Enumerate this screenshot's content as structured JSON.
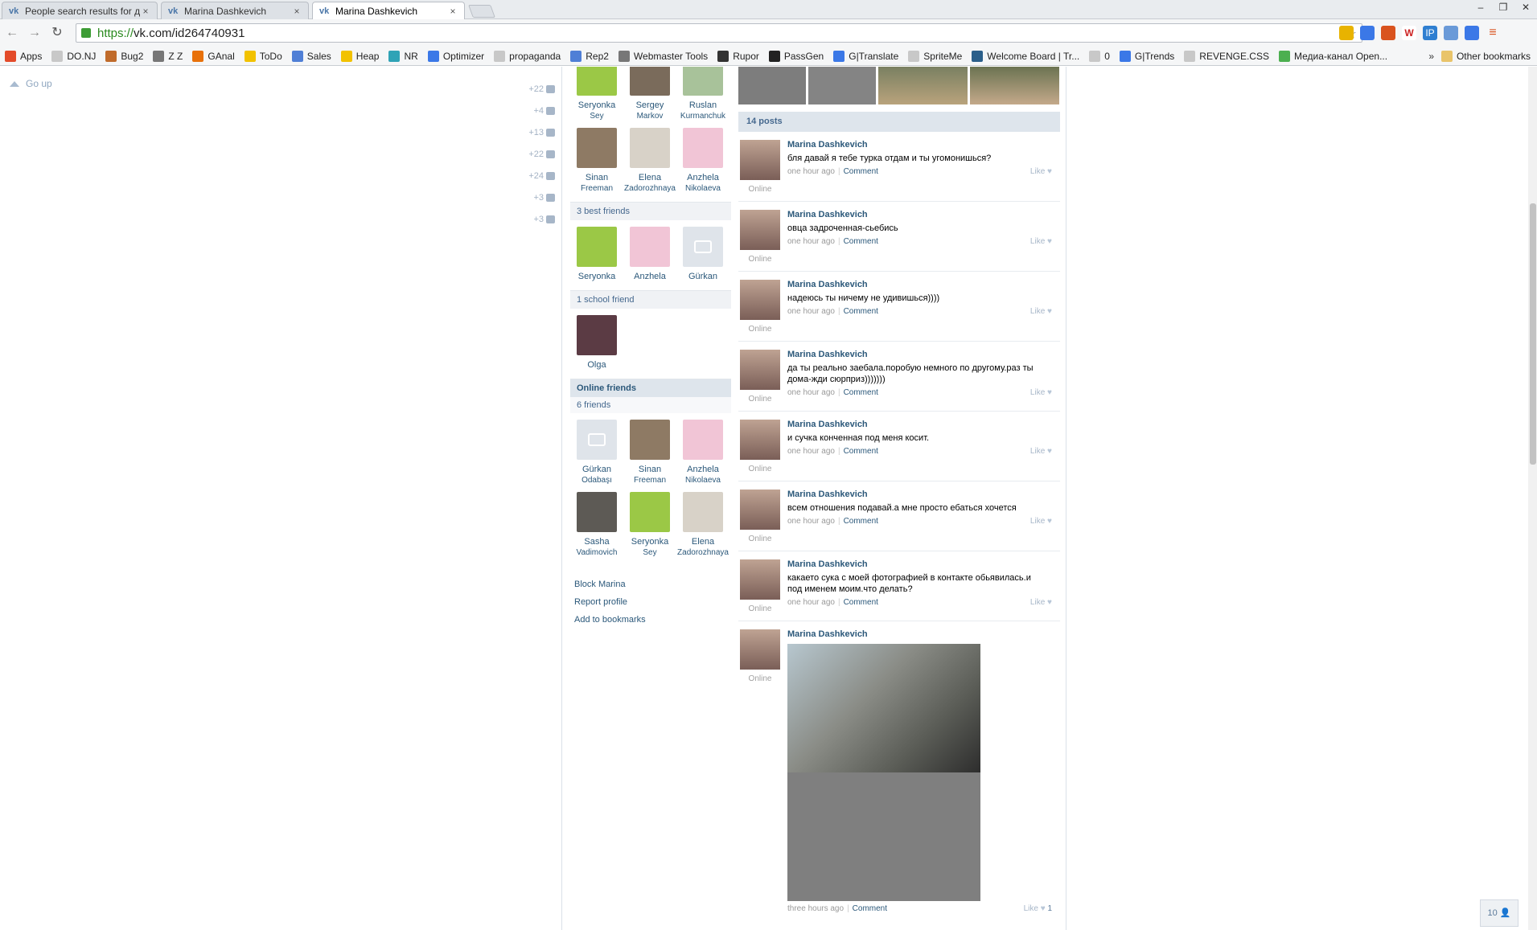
{
  "browser": {
    "tabs": [
      {
        "title": "People search results for д",
        "active": false
      },
      {
        "title": "Marina Dashkevich",
        "active": false
      },
      {
        "title": "Marina Dashkevich",
        "active": true
      }
    ],
    "url_scheme": "https://",
    "url_rest": "vk.com/id264740931",
    "bookmarks": [
      {
        "label": "Apps",
        "icon": "apps-grid-icon",
        "color": "#e34b2a"
      },
      {
        "label": "DO.NJ",
        "icon": "page-icon",
        "color": "#c8c8c8"
      },
      {
        "label": "Bug2",
        "icon": "bug-icon",
        "color": "#c06b2b"
      },
      {
        "label": "Z Z",
        "icon": "zz-icon",
        "color": "#777777"
      },
      {
        "label": "GAnal",
        "icon": "chart-icon",
        "color": "#e8710a"
      },
      {
        "label": "ToDo",
        "icon": "todo-icon",
        "color": "#f2c200"
      },
      {
        "label": "Sales",
        "icon": "sales-icon",
        "color": "#4f7fd6"
      },
      {
        "label": "Heap",
        "icon": "heap-icon",
        "color": "#f2c200"
      },
      {
        "label": "NR",
        "icon": "nr-icon",
        "color": "#2fa3b6"
      },
      {
        "label": "Optimizer",
        "icon": "google-icon",
        "color": "#3b78e7"
      },
      {
        "label": "propaganda",
        "icon": "page-icon",
        "color": "#c8c8c8"
      },
      {
        "label": "Rep2",
        "icon": "rep-icon",
        "color": "#4f7fd6"
      },
      {
        "label": "Webmaster Tools",
        "icon": "webmaster-icon",
        "color": "#777777"
      },
      {
        "label": "Rupor",
        "icon": "rupor-icon",
        "color": "#333333"
      },
      {
        "label": "PassGen",
        "icon": "passgen-icon",
        "color": "#222222"
      },
      {
        "label": "G|Translate",
        "icon": "translate-icon",
        "color": "#3b78e7"
      },
      {
        "label": "SpriteMe",
        "icon": "page-icon",
        "color": "#c8c8c8"
      },
      {
        "label": "Welcome Board | Tr...",
        "icon": "trello-icon",
        "color": "#2b5f8a"
      },
      {
        "label": "0",
        "icon": "page-icon",
        "color": "#c8c8c8"
      },
      {
        "label": "G|Trends",
        "icon": "google-icon",
        "color": "#3b78e7"
      },
      {
        "label": "REVENGE.CSS",
        "icon": "page-icon",
        "color": "#c8c8c8"
      },
      {
        "label": "Медиа-канал Open...",
        "icon": "media-icon",
        "color": "#4caf50"
      }
    ],
    "other_bookmarks": "Other bookmarks",
    "chevron": "»"
  },
  "page": {
    "go_up": "Go up",
    "counters": [
      "+22",
      "+4",
      "+13",
      "+22",
      "+24",
      "+3",
      "+3"
    ],
    "friends_top": [
      {
        "first": "Seryonka",
        "last": "Sey",
        "avatar": "#9bc846"
      },
      {
        "first": "Sergey",
        "last": "Markov",
        "avatar": "#7a6b5b"
      },
      {
        "first": "Ruslan",
        "last": "Kurmanchuk",
        "avatar": "#a8c29a"
      },
      {
        "first": "Sinan",
        "last": "Freeman",
        "avatar": "#8e7a64"
      },
      {
        "first": "Elena",
        "last": "Zadorozhnaya",
        "avatar": "#d8d2c8"
      },
      {
        "first": "Anzhela",
        "last": "Nikolaeva",
        "avatar": "#f1c5d6"
      }
    ],
    "best_friends_header": "3 best friends",
    "best_friends": [
      {
        "name": "Seryonka",
        "avatar": "#9bc846"
      },
      {
        "name": "Anzhela",
        "avatar": "#f1c5d6"
      },
      {
        "name": "Gürkan",
        "avatar": "#dfe4ea"
      }
    ],
    "school_header": "1 school friend",
    "school_friends": [
      {
        "name": "Olga",
        "avatar": "#5b3b44"
      }
    ],
    "online_header": "Online friends",
    "online_count": "6 friends",
    "online_friends": [
      {
        "first": "Gürkan",
        "last": "Odabaşı",
        "avatar": "#dfe4ea"
      },
      {
        "first": "Sinan",
        "last": "Freeman",
        "avatar": "#8e7a64"
      },
      {
        "first": "Anzhela",
        "last": "Nikolaeva",
        "avatar": "#f1c5d6"
      },
      {
        "first": "Sasha",
        "last": "Vadimovich",
        "avatar": "#5d5a55"
      },
      {
        "first": "Seryonka",
        "last": "Sey",
        "avatar": "#9bc846"
      },
      {
        "first": "Elena",
        "last": "Zadorozhnaya",
        "avatar": "#d8d2c8"
      }
    ],
    "actions": [
      "Block Marina",
      "Report profile",
      "Add to bookmarks"
    ],
    "posts_header": "14 posts",
    "posts": [
      {
        "author": "Marina Dashkevich",
        "text": "бля давай я тебе турка отдам и ты угомонишься?",
        "time": "one hour ago",
        "comment": "Comment",
        "like": "Like",
        "online": "Online"
      },
      {
        "author": "Marina Dashkevich",
        "text": "овца задроченная-сьебись",
        "time": "one hour ago",
        "comment": "Comment",
        "like": "Like",
        "online": "Online"
      },
      {
        "author": "Marina Dashkevich",
        "text": "надеюсь ты ничему не удивишься))))",
        "time": "one hour ago",
        "comment": "Comment",
        "like": "Like",
        "online": "Online"
      },
      {
        "author": "Marina Dashkevich",
        "text": "да ты реально заебала.поробую немного по другому.раз ты дома-жди сюрприз)))))))",
        "time": "one hour ago",
        "comment": "Comment",
        "like": "Like",
        "online": "Online"
      },
      {
        "author": "Marina Dashkevich",
        "text": "и сучка конченная под меня косит.",
        "time": "one hour ago",
        "comment": "Comment",
        "like": "Like",
        "online": "Online"
      },
      {
        "author": "Marina Dashkevich",
        "text": "всем отношения подавай.а мне просто ебаться хочется",
        "time": "one hour ago",
        "comment": "Comment",
        "like": "Like",
        "online": "Online"
      },
      {
        "author": "Marina Dashkevich",
        "text": "какаето сука с моей фотографией в контакте обьявилась.и под именем моим.что делать?",
        "time": "one hour ago",
        "comment": "Comment",
        "like": "Like",
        "online": "Online"
      }
    ],
    "photo_post": {
      "author": "Marina Dashkevich",
      "online": "Online",
      "time": "three hours ago",
      "comment": "Comment",
      "like": "Like",
      "like_count": "1"
    },
    "bottom_badge": "10"
  }
}
